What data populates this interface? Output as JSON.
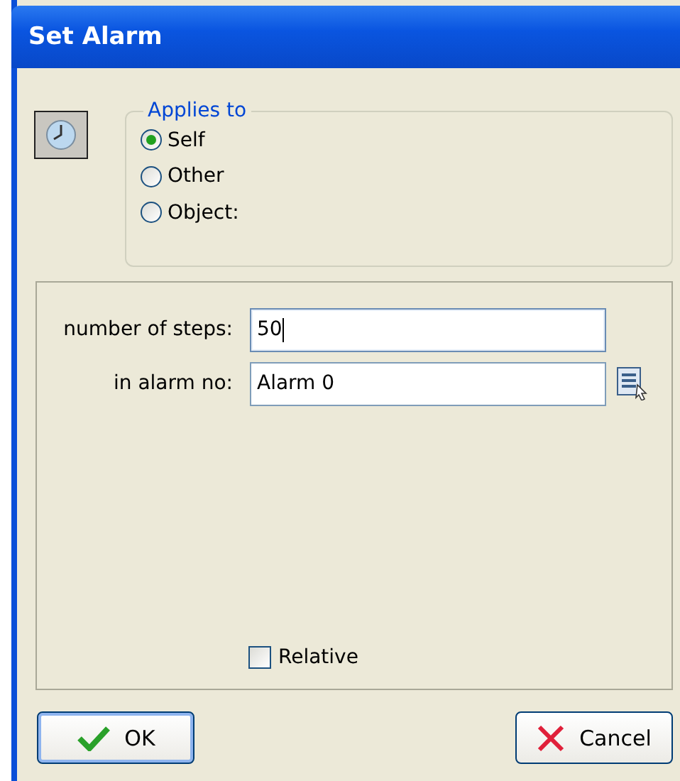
{
  "window": {
    "title": "Set Alarm"
  },
  "applies_to": {
    "title": "Applies to",
    "options": [
      {
        "label": "Self",
        "selected": true
      },
      {
        "label": "Other",
        "selected": false
      },
      {
        "label": "Object:",
        "selected": false
      }
    ]
  },
  "fields": [
    {
      "label": "number of steps:",
      "value": "50",
      "focused": true,
      "has_menu": false
    },
    {
      "label": "in alarm no:",
      "value": "Alarm 0",
      "focused": false,
      "has_menu": true
    }
  ],
  "relative": {
    "label": "Relative",
    "checked": false
  },
  "buttons": [
    {
      "kind": "ok",
      "label": "OK"
    },
    {
      "kind": "cancel",
      "label": "Cancel"
    }
  ]
}
